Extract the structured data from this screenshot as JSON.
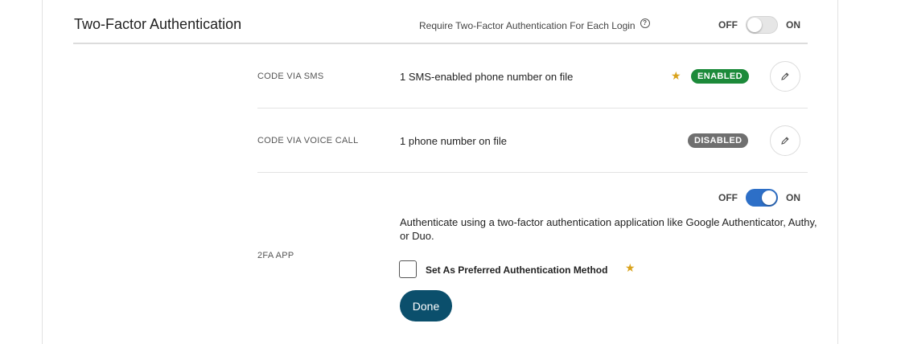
{
  "section": {
    "title": "Two-Factor Authentication",
    "require_label": "Require Two-Factor Authentication For Each Login",
    "require_toggle": {
      "off_label": "OFF",
      "on_label": "ON",
      "state": "off"
    }
  },
  "methods": {
    "sms": {
      "label": "CODE VIA SMS",
      "description": "1 SMS-enabled phone number on file",
      "preferred_star": "★",
      "status": "ENABLED"
    },
    "voice": {
      "label": "CODE VIA VOICE CALL",
      "description": "1 phone number on file",
      "status": "DISABLED"
    },
    "app": {
      "label": "2FA APP",
      "toggle": {
        "off_label": "OFF",
        "on_label": "ON",
        "state": "on"
      },
      "description": "Authenticate using a two-factor authentication application like Google Authenticator, Authy, or Duo.",
      "preferred_checkbox_label": "Set As Preferred Authentication Method",
      "preferred_checked": false,
      "preferred_star": "★",
      "done_label": "Done"
    }
  },
  "icons": {
    "help": "help-circle-icon",
    "edit": "pencil-icon",
    "star": "star-icon"
  },
  "colors": {
    "enabled_badge": "#1c8a3a",
    "disabled_badge": "#6f6f6f",
    "toggle_on": "#2d6fc7",
    "done_button": "#0b4f6c",
    "star": "#d9a21b"
  }
}
